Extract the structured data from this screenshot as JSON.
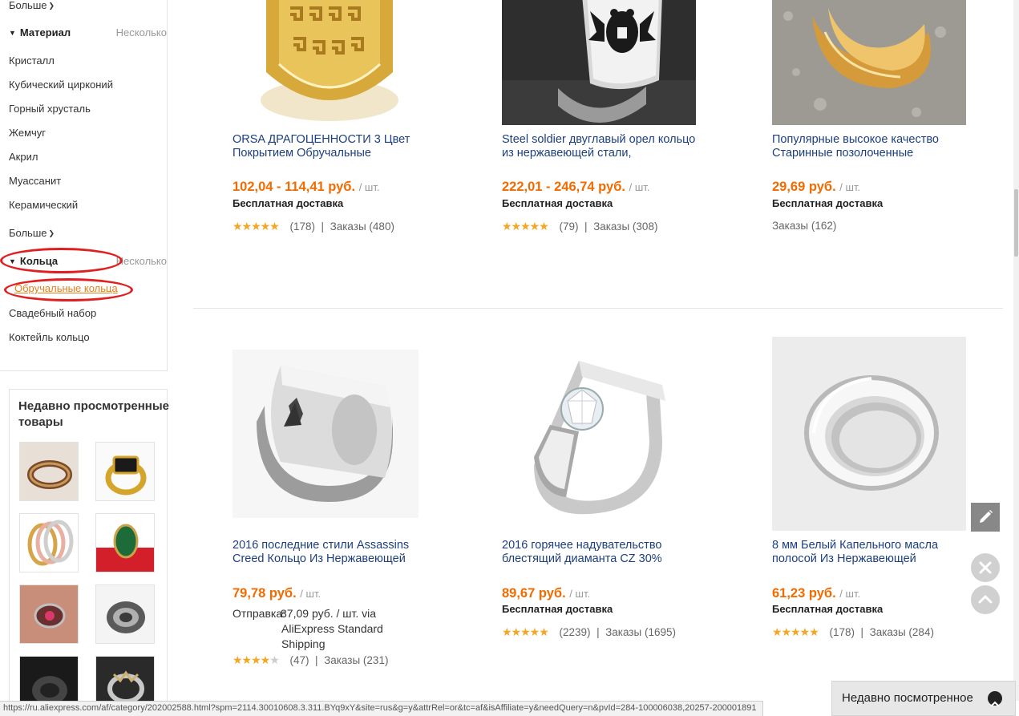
{
  "sidebar": {
    "more_label": "Больше",
    "material": {
      "title": "Материал",
      "multi_label": "Несколько",
      "items": [
        "Кристалл",
        "Кубический цирконий",
        "Горный хрусталь",
        "Жемчуг",
        "Акрил",
        "Муассанит",
        "Керамический"
      ],
      "more_label": "Больше"
    },
    "rings": {
      "title": "Кольца",
      "multi_label": "Несколько",
      "items": [
        "Обручальные кольца",
        "Свадебный набор",
        "Коктейль кольцо"
      ],
      "active_item": "Обручальные кольца"
    },
    "recent": {
      "title": "Недавно просмотренные товары",
      "thumbs": [
        "ring-thumb-1",
        "ring-thumb-2",
        "ring-thumb-3",
        "ring-thumb-4",
        "ring-thumb-5",
        "ring-thumb-6",
        "ring-thumb-7",
        "ring-thumb-8"
      ]
    }
  },
  "products": [
    {
      "title": "ORSA ДРАГОЦЕННОСТИ 3 Цвет Покрытием Обручальные",
      "price": "102,04 - 114,41 руб.",
      "unit": "/ шт.",
      "shipping": "Бесплатная доставка",
      "rating": 5,
      "reviews": "(178)",
      "orders": "Заказы (480)"
    },
    {
      "title": "Steel soldier двуглавый орел кольцо из нержавеющей стали,",
      "price": "222,01 - 246,74 руб.",
      "unit": "/ шт.",
      "shipping": "Бесплатная доставка",
      "rating": 5,
      "reviews": "(79)",
      "orders": "Заказы (308)"
    },
    {
      "title": "Популярные высокое качество Старинные позолоченные",
      "price": "29,69 руб.",
      "unit": "/ шт.",
      "shipping": "Бесплатная доставка",
      "rating": null,
      "reviews": "",
      "orders": "Заказы (162)"
    },
    {
      "title": "2016 последние стили Assassins Creed Кольцо Из Нержавеющей",
      "price": "79,78 руб.",
      "unit": "/ шт.",
      "shipping_prefix": "Отправка:",
      "shipping_cost": "87,09 руб. / шт. via",
      "shipping_line2": "AliExpress Standard",
      "shipping_line3": "Shipping",
      "rating": 4,
      "reviews": "(47)",
      "orders": "Заказы (231)"
    },
    {
      "title": "2016 горячее надувательство блестящий диаманта CZ 30%",
      "price": "89,67 руб.",
      "unit": "/ шт.",
      "shipping": "Бесплатная доставка",
      "rating": 5,
      "reviews": "(2239)",
      "orders": "Заказы (1695)"
    },
    {
      "title": "8 мм Белый Капельного масла полосой Из Нержавеющей",
      "price": "61,23 руб.",
      "unit": "/ шт.",
      "shipping": "Бесплатная доставка",
      "rating": 5,
      "reviews": "(178)",
      "orders": "Заказы (284)"
    }
  ],
  "status_url": "https://ru.aliexpress.com/af/category/202002588.html?spm=2114.30010608.3.311.BYq9xY&site=rus&g=y&attrRel=or&tc=af&isAffiliate=y&needQuery=n&pvId=284-100006038,20257-200001891",
  "recent_tab_label": "Недавно посмотренное",
  "colors": {
    "price": "#f26b00",
    "title_link": "#1c3f7d",
    "star": "#f5a623",
    "annotation": "#e02020",
    "active_filter": "#e5801f"
  }
}
